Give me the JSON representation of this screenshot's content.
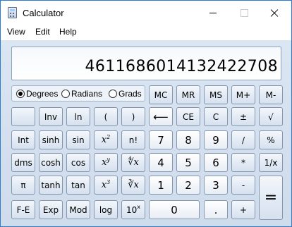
{
  "window": {
    "title": "Calculator"
  },
  "menu": [
    "View",
    "Edit",
    "Help"
  ],
  "display": {
    "value": "4611686014132422708"
  },
  "angle": {
    "degrees": "Degrees",
    "radians": "Radians",
    "grads": "Grads",
    "selected": "Degrees"
  },
  "memory": {
    "mc": "MC",
    "mr": "MR",
    "ms": "MS",
    "mplus": "M+",
    "mminus": "M-"
  },
  "keys": {
    "inv": "Inv",
    "ln": "ln",
    "lparen": "(",
    "rparen": ")",
    "backspace": "⟵",
    "ce": "CE",
    "c": "C",
    "negate": "±",
    "sqrt": "√",
    "int": "Int",
    "sinh": "sinh",
    "sin": "sin",
    "x2": "x",
    "x2_sup": "2",
    "fact": "n!",
    "n7": "7",
    "n8": "8",
    "n9": "9",
    "div": "/",
    "pct": "%",
    "dms": "dms",
    "cosh": "cosh",
    "cos": "cos",
    "xy": "x",
    "xy_sup": "y",
    "yroot": "∜x",
    "n4": "4",
    "n5": "5",
    "n6": "6",
    "mul": "*",
    "recip": "1/x",
    "pi": "π",
    "tanh": "tanh",
    "tan": "tan",
    "x3": "x",
    "x3_sup": "3",
    "cbrt": "∛x",
    "n1": "1",
    "n2": "2",
    "n3": "3",
    "sub": "-",
    "eq": "=",
    "fe": "F-E",
    "exp": "Exp",
    "mod": "Mod",
    "log": "log",
    "tenx": "10",
    "tenx_sup": "x",
    "n0": "0",
    "dot": ".",
    "add": "+"
  }
}
